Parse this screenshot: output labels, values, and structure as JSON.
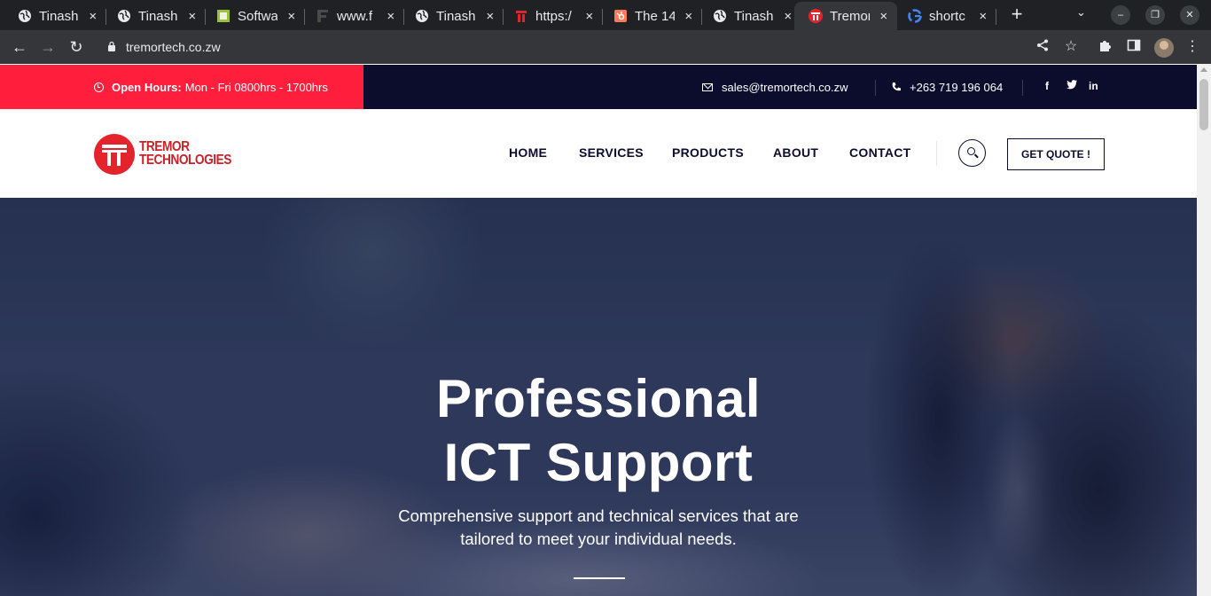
{
  "browser": {
    "tabs": [
      {
        "title": "Tinashe",
        "favicon": "globe-icon"
      },
      {
        "title": "Tinashe",
        "favicon": "globe-icon"
      },
      {
        "title": "Software",
        "favicon": "square-green-icon"
      },
      {
        "title": "www.f",
        "favicon": "f-letter-icon"
      },
      {
        "title": "Tinashe",
        "favicon": "globe-icon"
      },
      {
        "title": "https:/",
        "favicon": "tremor-icon"
      },
      {
        "title": "The 14",
        "favicon": "hubspot-icon"
      },
      {
        "title": "Tinashe",
        "favicon": "globe-icon"
      },
      {
        "title": "Tremor",
        "favicon": "tremor-red-icon",
        "active": true
      },
      {
        "title": "shortc",
        "favicon": "google-icon"
      }
    ],
    "close_glyph": "×",
    "new_tab_glyph": "+",
    "url": "tremortech.co.zw",
    "colors": {
      "chrome_bg": "#202124",
      "toolbar_bg": "#35363a"
    }
  },
  "site": {
    "topbar": {
      "hours_label": "Open Hours:",
      "hours_value": "Mon - Fri 0800hrs - 1700hrs",
      "email": "sales@tremortech.co.zw",
      "phone": "+263 719 196 064",
      "social": [
        "f",
        "t",
        "in"
      ],
      "colors": {
        "accent": "#ff1e3b",
        "dark": "#0c0c2d"
      }
    },
    "logo": {
      "line1": "TREMOR",
      "line2": "TECHNOLOGIES",
      "color": "#e4242d"
    },
    "nav": [
      "HOME",
      "SERVICES",
      "PRODUCTS",
      "ABOUT",
      "CONTACT"
    ],
    "quote_button": "GET QUOTE !",
    "hero": {
      "title_line1": "Professional",
      "title_line2": "ICT Support",
      "subtitle_line1": "Comprehensive support and technical services that are",
      "subtitle_line2": "tailored to meet your individual needs."
    }
  }
}
